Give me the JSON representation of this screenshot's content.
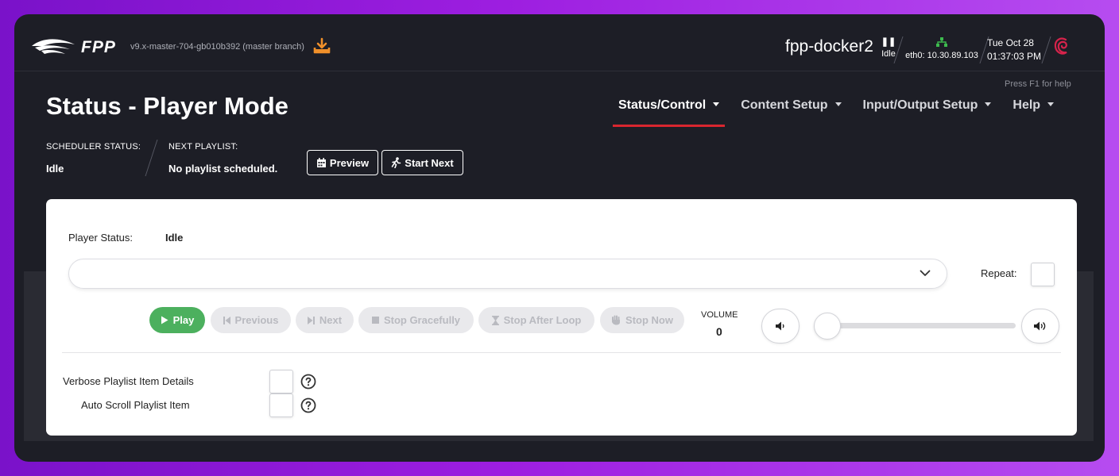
{
  "header": {
    "brand": "FPP",
    "version": "v9.x-master-704-gb010b392 (master branch)",
    "hostname": "fpp-docker2",
    "player_state": "Idle",
    "network": "eth0: 10.30.89.103",
    "date": "Tue Oct 28",
    "time": "01:37:03 PM",
    "help_hint": "Press F1 for help"
  },
  "page": {
    "title": "Status - Player Mode"
  },
  "nav": [
    {
      "label": "Status/Control"
    },
    {
      "label": "Content Setup"
    },
    {
      "label": "Input/Output Setup"
    },
    {
      "label": "Help"
    }
  ],
  "scheduler": {
    "status_label": "SCHEDULER STATUS:",
    "status_value": "Idle",
    "next_label": "NEXT PLAYLIST:",
    "next_value": "No playlist scheduled.",
    "preview_label": "Preview",
    "start_next_label": "Start Next"
  },
  "player": {
    "status_label": "Player Status:",
    "status_value": "Idle",
    "repeat_label": "Repeat:",
    "controls": [
      {
        "label": "Play"
      },
      {
        "label": "Previous"
      },
      {
        "label": "Next"
      },
      {
        "label": "Stop Gracefully"
      },
      {
        "label": "Stop After Loop"
      },
      {
        "label": "Stop Now"
      }
    ],
    "volume_label": "VOLUME",
    "volume_value": "0",
    "volume_level": 0
  },
  "options": {
    "verbose_label": "Verbose Playlist Item Details",
    "autoscroll_label": "Auto Scroll Playlist Item"
  },
  "colors": {
    "accent_red": "#d9262f",
    "play_green": "#4cb05e",
    "download_orange": "#f0902a",
    "network_green": "#3dba4e"
  }
}
